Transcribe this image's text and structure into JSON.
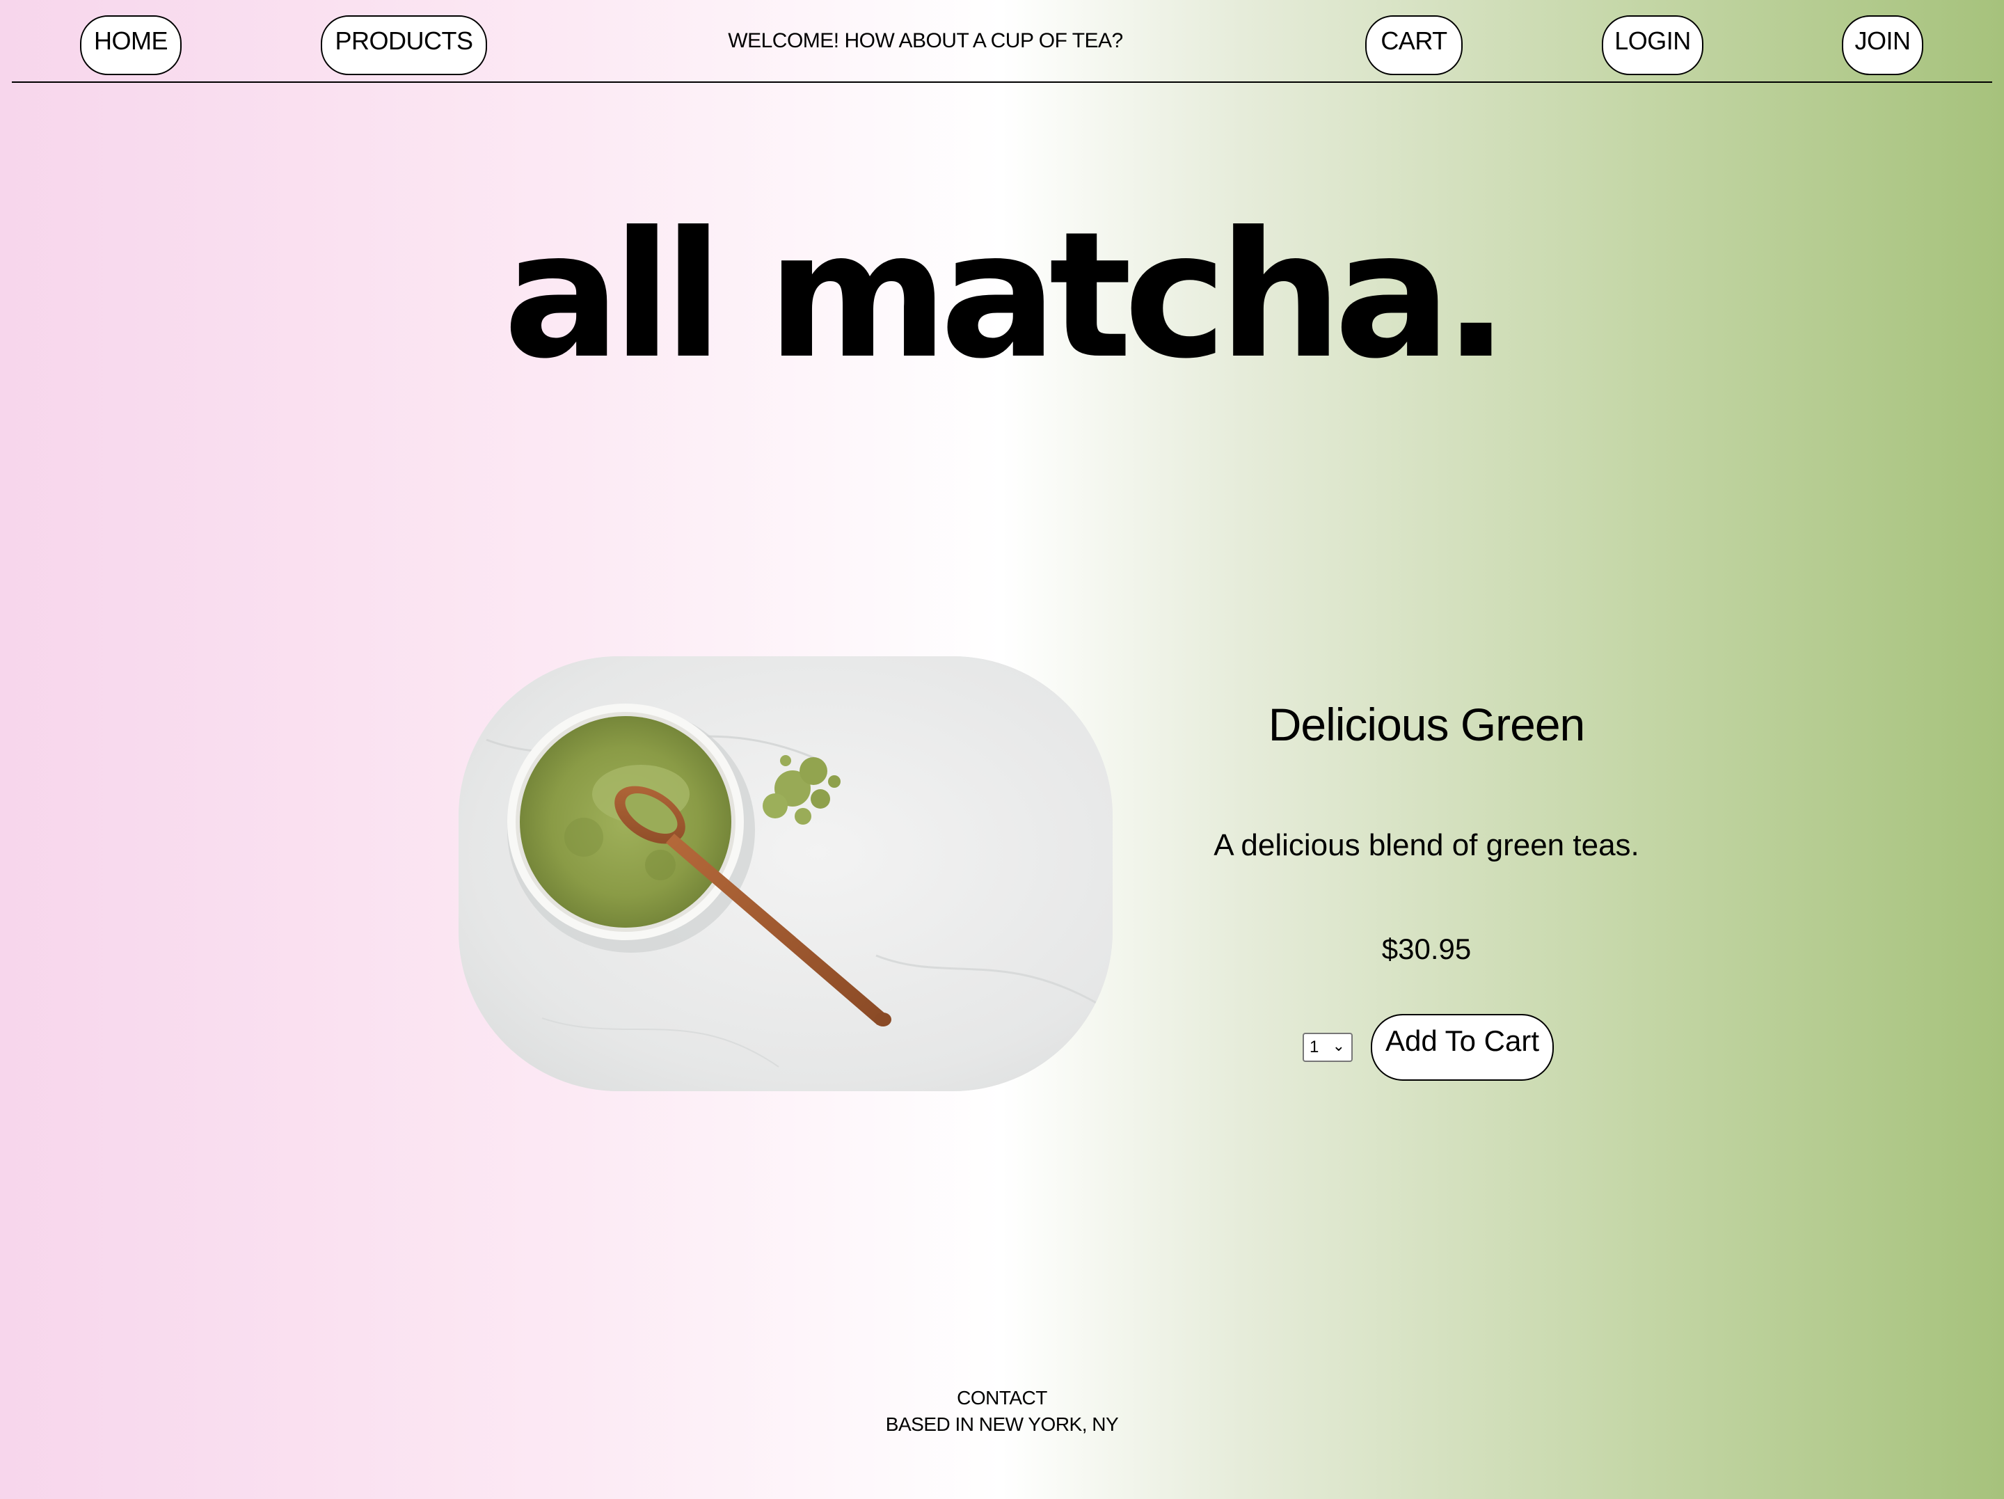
{
  "nav": {
    "home_label": "HOME",
    "products_label": "PRODUCTS",
    "welcome_text": "WELCOME! HOW ABOUT A CUP OF TEA?",
    "cart_label": "CART",
    "login_label": "LOGIN",
    "join_label": "JOIN"
  },
  "hero": {
    "title": "all matcha."
  },
  "product": {
    "image_icon": "matcha-bowl-photo",
    "name": "Delicious Green",
    "description": "A delicious blend of green teas.",
    "price": "$30.95",
    "quantity": "1",
    "add_to_cart_label": "Add To Cart"
  },
  "footer": {
    "contact_label": "CONTACT",
    "location": "BASED IN NEW YORK, NY"
  },
  "colors": {
    "gradient_left": "#f7d6ec",
    "gradient_middle": "#ffffff",
    "gradient_right": "#a6c27c",
    "matcha_green": "#8ea04c"
  }
}
